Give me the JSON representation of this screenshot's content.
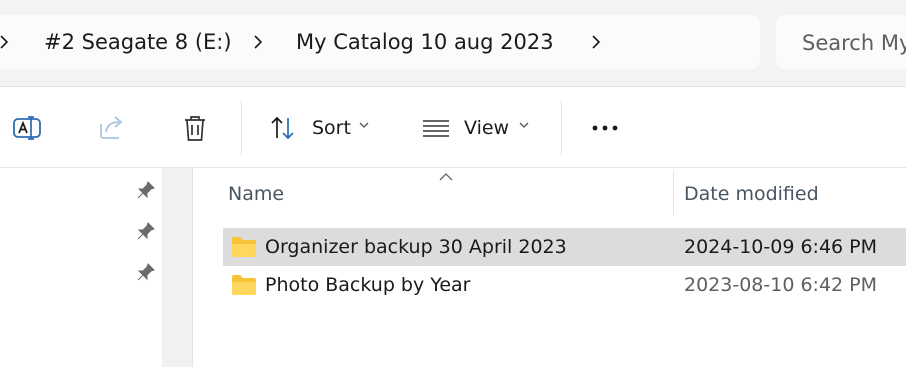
{
  "address_bar": {
    "breadcrumbs": [
      "#2 Seagate 8 (E:)",
      "My Catalog 10 aug 2023"
    ],
    "search_placeholder": "Search My"
  },
  "toolbar": {
    "sort_label": "Sort",
    "view_label": "View",
    "icons": [
      "rename-icon",
      "share-icon",
      "delete-icon",
      "sort-icon",
      "view-icon",
      "more-icon"
    ]
  },
  "columns": {
    "name": "Name",
    "date_modified": "Date modified"
  },
  "files": [
    {
      "name": "Organizer backup 30 April 2023",
      "date": "2024-10-09 6:46 PM",
      "selected": true
    },
    {
      "name": "Photo Backup by Year",
      "date": "2023-08-10 6:42 PM",
      "selected": false
    }
  ],
  "colors": {
    "selected_row": "#dcdcdc",
    "folder": "#f8c43a",
    "accent": "#0067c0"
  }
}
